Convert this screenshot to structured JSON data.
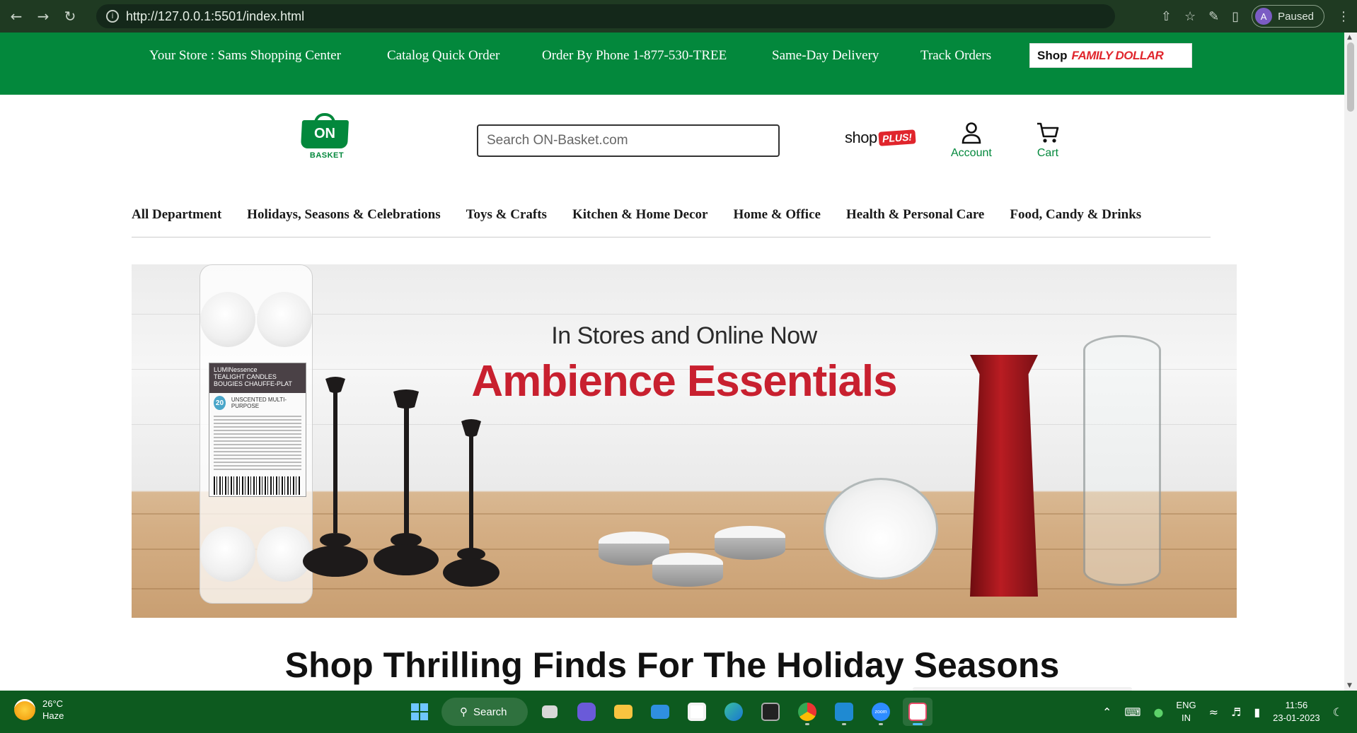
{
  "browser": {
    "url": "http://127.0.0.1:5501/index.html",
    "profile_initial": "A",
    "profile_status": "Paused"
  },
  "topbar": {
    "store": "Your Store : Sams Shopping Center",
    "catalog": "Catalog Quick Order",
    "phone": "Order By Phone 1-877-530-TREE",
    "delivery": "Same-Day Delivery",
    "track": "Track Orders",
    "family_shop": "Shop",
    "family_brand": "FAMILY DOLLAR"
  },
  "header": {
    "logo_on": "ON",
    "logo_basket": "BASKET",
    "search_placeholder": "Search ON-Basket.com",
    "shop_text": "shop",
    "plus_text": "PLUS!",
    "account_label": "Account",
    "cart_label": "Cart"
  },
  "categories": [
    "All Department",
    "Holidays, Seasons & Celebrations",
    "Toys & Crafts",
    "Kitchen & Home Decor",
    "Home & Office",
    "Health & Personal Care",
    "Food, Candy & Drinks"
  ],
  "banner": {
    "subtitle": "In Stores and Online Now",
    "title": "Ambience Essentials",
    "pack_brand": "LUMINessence",
    "pack_type": "TEALIGHT CANDLES",
    "pack_type_fr": "BOUGIES CHAUFFE-PLAT",
    "pack_count": "20",
    "pack_desc": "UNSCENTED MULTI-PURPOSE"
  },
  "section": {
    "title": "Shop Thrilling Finds For The Holiday Seasons"
  },
  "taskbar": {
    "temp": "26°C",
    "weather": "Haze",
    "search_label": "Search",
    "lang": "ENG",
    "region": "IN",
    "time": "11:56",
    "date": "23-01-2023",
    "zoom_label": "zoom"
  },
  "colors": {
    "brand_green": "#03883c",
    "accent_red": "#c8202f"
  }
}
